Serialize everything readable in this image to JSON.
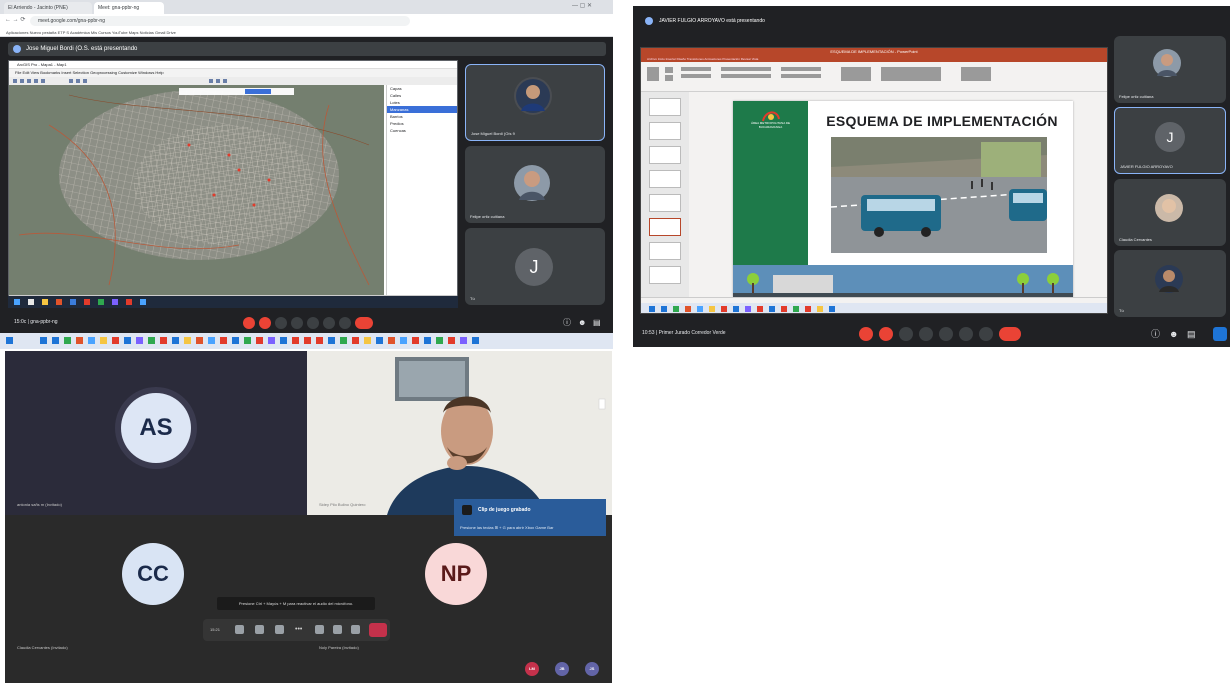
{
  "panel1": {
    "tabs": [
      "El Arriendo - Jacinto (PNE)",
      "Meet: gna-ppbr-ng"
    ],
    "url": "meet.google.com/gna-ppbr-ng",
    "bookmarks": "Aplicaciones   Nuevo pestaña   ETP S Académica   Mis Cursos   YouTube   Maps   Noticias   Gmail   Drive",
    "presenter_banner": "Jose Miguel Bordi (O.S. está presentando",
    "app_title": "ArcGIS Pro - Mapa1 - Map1",
    "app_menu": "File  Edit  View  Bookmarks  Insert  Selection  Geoprocessing  Customize  Windows  Help",
    "layers": [
      "Capas",
      "Calles",
      "Lotes",
      "Manzanas",
      "Barrios",
      "Predios",
      "Cuencas"
    ],
    "participants": [
      {
        "name": "Jose Miguel Bordi (Oís 9"
      },
      {
        "name": "Felipe ortiz cuitiana"
      },
      {
        "letter": "J",
        "name": "Tú"
      }
    ],
    "meeting_status": "15:0c  |  gna-ppbr-ng"
  },
  "panel2": {
    "presenter_banner": "JAVIER FULGIO ARROYAVO está presentando",
    "ppt_title": "ESQUEMA DE IMPLEMENTACIÓN - PowerPoint",
    "ppt_tabs": "Archivo   Inicio   Insertar   Diseño   Transiciones   Animaciones   Presentación   Revisar   Vista",
    "slide_org": "ÁREA METROPOLITANA DE BUCARAMANGA",
    "slide_heading": "ESQUEMA DE IMPLEMENTACIÓN",
    "participants": [
      {
        "name": "Felipe ortiz cuitiana"
      },
      {
        "letter": "J",
        "name": "JAVIER FULGIO ARROYAVO"
      },
      {
        "name": "Claudia Cervantes"
      },
      {
        "name": "Tú"
      }
    ],
    "meeting_status": "10:53  |  Primer Jurado Corredor Verde"
  },
  "panel3": {
    "tiles": [
      {
        "initials": "AS",
        "name": "antonia sañs m (Invitado)"
      },
      {
        "name": "Sidey Pilo Bulino Quintero"
      },
      {
        "initials": "CC",
        "name": "Claudia Cervantes (Invitado)"
      },
      {
        "initials": "NP",
        "name": "Noly Pareira (Invitado)"
      }
    ],
    "toast_title": "Clip de juego grabado",
    "toast_body": "Presione las teclas ⊞ + G para abrir Xbox Game Bar",
    "hint": "Presione Ctrl + Mayús + M para reactivar el audio del micrófono.",
    "call_time": "15:21",
    "small_avatars": [
      "LM",
      "JB",
      "JS"
    ]
  },
  "colors": {
    "meet_dark": "#202124",
    "end_call": "#ea4335",
    "teams_bg": "#292929",
    "toast": "#2a5c9a",
    "slide_green": "#1e7a4a"
  }
}
